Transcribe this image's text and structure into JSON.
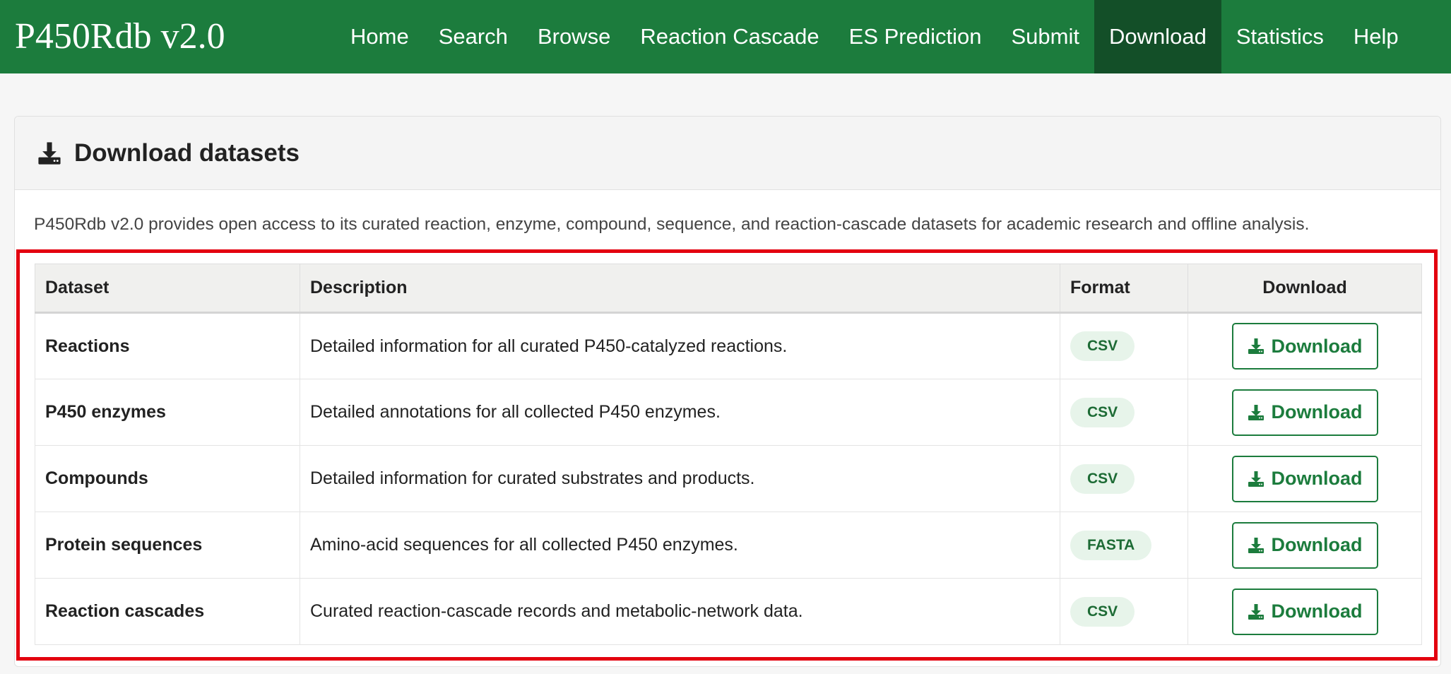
{
  "nav": {
    "brand": "P450Rdb v2.0",
    "items": [
      {
        "label": "Home"
      },
      {
        "label": "Search"
      },
      {
        "label": "Browse"
      },
      {
        "label": "Reaction Cascade"
      },
      {
        "label": "ES Prediction"
      },
      {
        "label": "Submit"
      },
      {
        "label": "Download",
        "active": true
      },
      {
        "label": "Statistics"
      },
      {
        "label": "Help"
      }
    ]
  },
  "panel": {
    "icon": "download-icon",
    "title": "Download datasets",
    "intro": "P450Rdb v2.0 provides open access to its curated reaction, enzyme, compound, sequence, and reaction-cascade datasets for academic research and offline analysis."
  },
  "table": {
    "headers": {
      "dataset": "Dataset",
      "description": "Description",
      "format": "Format",
      "download": "Download"
    },
    "rows": [
      {
        "dataset": "Reactions",
        "description": "Detailed information for all curated P450-catalyzed reactions.",
        "format": "CSV",
        "button": "Download"
      },
      {
        "dataset": "P450 enzymes",
        "description": "Detailed annotations for all collected P450 enzymes.",
        "format": "CSV",
        "button": "Download"
      },
      {
        "dataset": "Compounds",
        "description": "Detailed information for curated substrates and products.",
        "format": "CSV",
        "button": "Download"
      },
      {
        "dataset": "Protein sequences",
        "description": "Amino-acid sequences for all collected P450 enzymes.",
        "format": "FASTA",
        "button": "Download"
      },
      {
        "dataset": "Reaction cascades",
        "description": "Curated reaction-cascade records and metabolic-network data.",
        "format": "CSV",
        "button": "Download"
      }
    ]
  },
  "colors": {
    "brand_green": "#1c7c3d",
    "active_nav": "#134f28",
    "highlight_border": "#e3000f",
    "badge_bg": "#e7f4ea"
  }
}
